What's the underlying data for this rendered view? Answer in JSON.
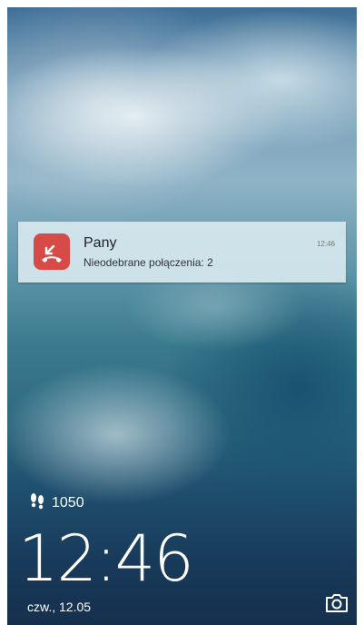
{
  "notification": {
    "title": "Pany",
    "time": "12:46",
    "body": "Nieodebrane połączenia: 2",
    "icon": "missed-call-icon",
    "icon_color": "#d64a48"
  },
  "steps": {
    "icon": "footsteps-icon",
    "count": "1050"
  },
  "clock": {
    "time": "12:46",
    "date": "czw., 12.05"
  },
  "shortcuts": {
    "camera_icon": "camera-icon"
  }
}
